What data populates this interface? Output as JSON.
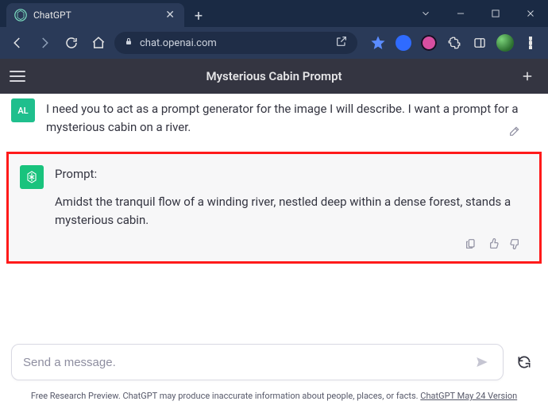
{
  "browser": {
    "tab_title": "ChatGPT",
    "url": "chat.openai.com"
  },
  "header": {
    "title": "Mysterious Cabin Prompt"
  },
  "messages": {
    "user": {
      "avatar_initials": "AL",
      "text": "I need you to act as a prompt generator for the image I will describe. I want a prompt for a mysterious cabin on a river."
    },
    "assistant": {
      "label": "Prompt:",
      "text": "Amidst the tranquil flow of a winding river, nestled deep within a dense forest, stands a mysterious cabin."
    }
  },
  "composer": {
    "placeholder": "Send a message."
  },
  "footer": {
    "text": "Free Research Preview. ChatGPT may produce inaccurate information about people, places, or facts. ",
    "link_text": "ChatGPT May 24 Version"
  }
}
